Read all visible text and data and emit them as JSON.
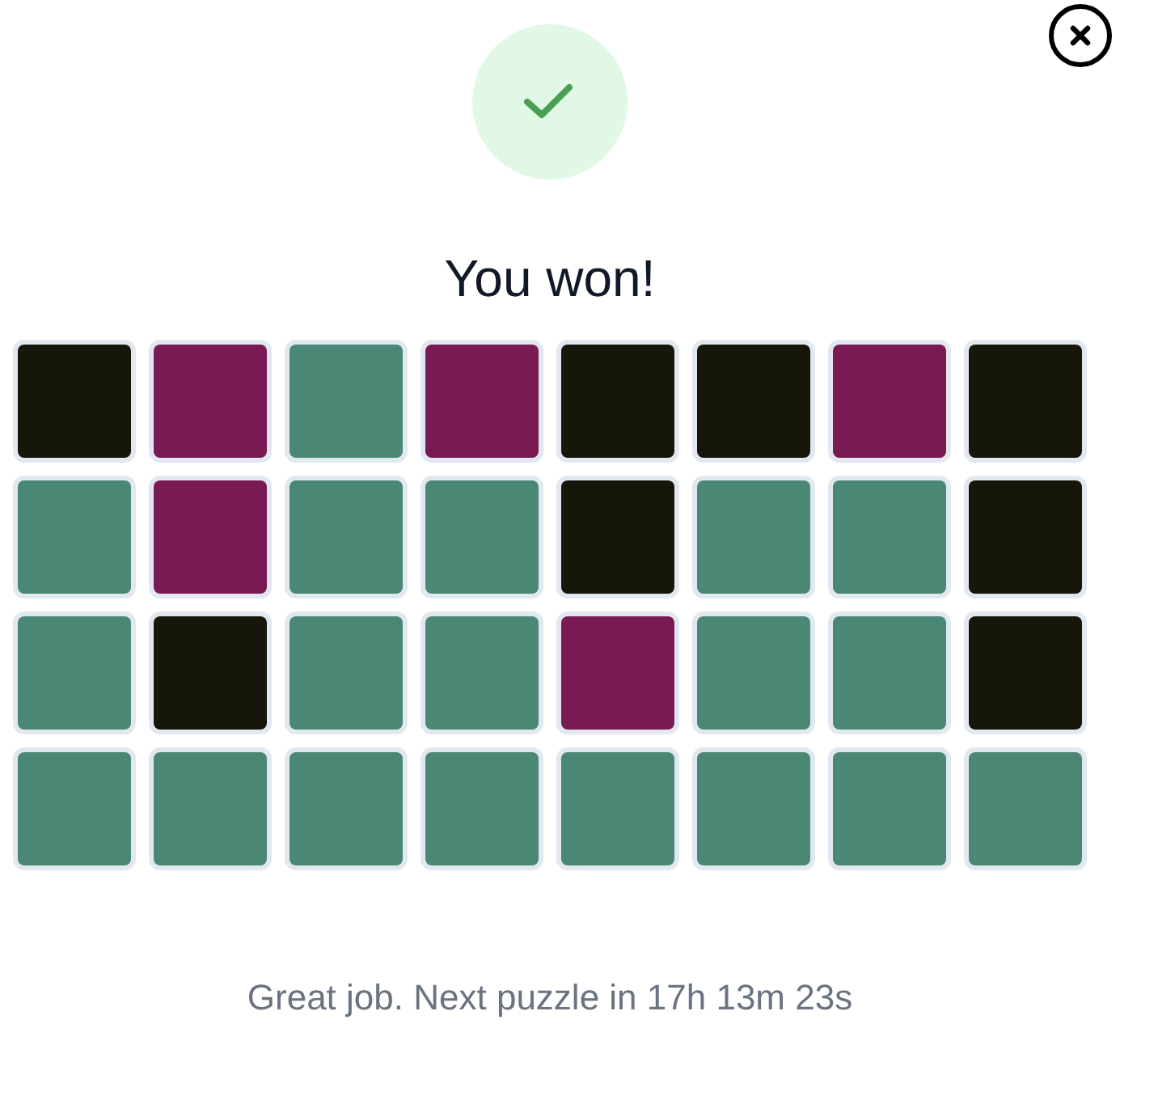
{
  "title": "You won!",
  "grid": [
    [
      {
        "color": "#16170a"
      },
      {
        "color": "#7a1a55"
      },
      {
        "color": "#4b8775"
      },
      {
        "color": "#7a1a55"
      },
      {
        "color": "#16170a"
      },
      {
        "color": "#16170a"
      },
      {
        "color": "#7a1a55"
      },
      {
        "color": "#16170a"
      }
    ],
    [
      {
        "color": "#4b8775"
      },
      {
        "color": "#7a1a55"
      },
      {
        "color": "#4b8775"
      },
      {
        "color": "#4b8775"
      },
      {
        "color": "#16170a"
      },
      {
        "color": "#4b8775"
      },
      {
        "color": "#4b8775"
      },
      {
        "color": "#16170a"
      }
    ],
    [
      {
        "color": "#4b8775"
      },
      {
        "color": "#16170a"
      },
      {
        "color": "#4b8775"
      },
      {
        "color": "#4b8775"
      },
      {
        "color": "#7a1a55"
      },
      {
        "color": "#4b8775"
      },
      {
        "color": "#4b8775"
      },
      {
        "color": "#16170a"
      }
    ],
    [
      {
        "color": "#4b8775"
      },
      {
        "color": "#4b8775"
      },
      {
        "color": "#4b8775"
      },
      {
        "color": "#4b8775"
      },
      {
        "color": "#4b8775"
      },
      {
        "color": "#4b8775"
      },
      {
        "color": "#4b8775"
      },
      {
        "color": "#4b8775"
      }
    ]
  ],
  "message": "Great job. Next puzzle in 17h 13m 23s"
}
